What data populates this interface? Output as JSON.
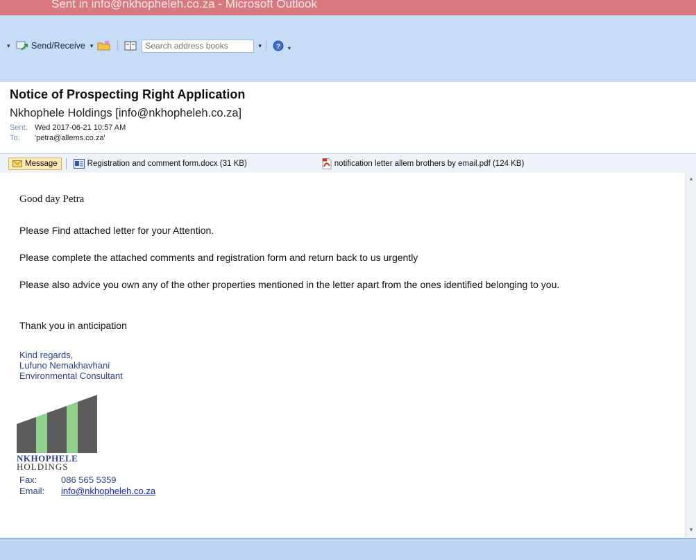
{
  "window": {
    "title": "Sent in info@nkhopheleh.co.za - Microsoft Outlook"
  },
  "toolbar": {
    "send_receive_label": "Send/Receive",
    "search_placeholder": "Search address books"
  },
  "email": {
    "subject": "Notice of Prospecting Right Application",
    "from": "Nkhophele Holdings [info@nkhopheleh.co.za]",
    "sent_label": "Sent:",
    "sent_value": "Wed 2017-06-21 10:57 AM",
    "to_label": "To:",
    "to_value": "'petra@allems.co.za'"
  },
  "attachments": {
    "message_tab": "Message",
    "items": [
      {
        "label": "Registration and comment form.docx (31 KB)",
        "icon": "word-doc-icon"
      },
      {
        "label": "notification letter allem brothers by email.pdf (124 KB)",
        "icon": "pdf-icon"
      }
    ]
  },
  "body": {
    "greeting": "Good day Petra",
    "paragraphs": [
      "Please Find attached letter for your Attention.",
      "Please complete the attached comments and registration form and return back to us urgently",
      "Please also advice you own any of the other properties mentioned in the letter apart from the ones identified belonging to you.",
      "Thank you in anticipation"
    ],
    "signature": {
      "closing": "Kind regards,",
      "name": "Lufuno Nemakhavhani",
      "title": "Environmental Consultant"
    },
    "logo": {
      "line1": "NKHOPHELE",
      "line2": "HOLDINGS",
      "colors": {
        "grey": "#5d5d5d",
        "green": "#8fd18c"
      }
    },
    "contact": {
      "fax_label": "Fax:",
      "fax_value": "086 565 5359",
      "email_label": "Email:",
      "email_value": "info@nkhopheleh.co.za"
    }
  },
  "colors": {
    "titlebar": "#d9797f",
    "toolbar": "#c7dcf6",
    "signature_text": "#2b3f8e",
    "link": "#1a22c4"
  }
}
